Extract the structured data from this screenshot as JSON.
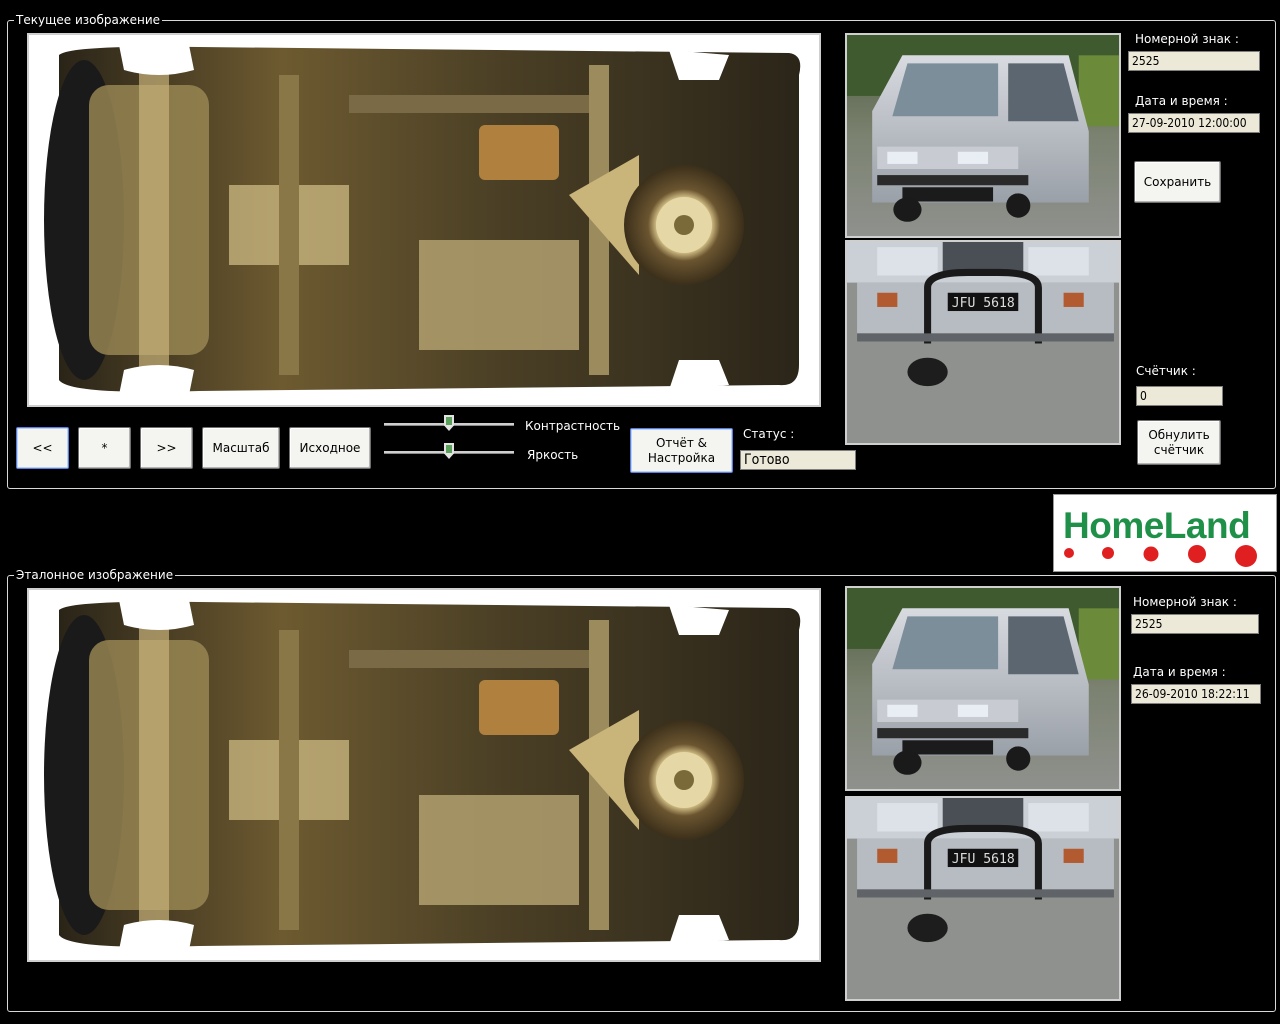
{
  "current": {
    "title": "Текущее изображение",
    "plate_label": "Номерной знак :",
    "plate_value": "2525",
    "datetime_label": "Дата и время :",
    "datetime_value": "27-09-2010 12:00:00",
    "save_label": "Сохранить",
    "counter_label": "Счётчик :",
    "counter_value": "0",
    "reset_counter_label": "Обнулить счётчик",
    "plate_text": "JFU 5618"
  },
  "controls": {
    "prev_label": "<<",
    "star_label": "*",
    "next_label": ">>",
    "scale_label": "Масштаб",
    "original_label": "Исходное",
    "contrast_label": "Контрастность",
    "contrast_level": 0.5,
    "brightness_label": "Яркость",
    "brightness_level": 0.5,
    "report_label": "Отчёт & Настройка",
    "status_label": "Статус :",
    "status_value": "Готово"
  },
  "reference": {
    "title": "Эталонное изображение",
    "plate_label": "Номерной знак :",
    "plate_value": "2525",
    "datetime_label": "Дата и время :",
    "datetime_value": "26-09-2010 18:22:11",
    "plate_text": "JFU 5618"
  },
  "logo": {
    "text": "HomeLand",
    "text_color": "#1e9048",
    "dot_color": "#e02020"
  },
  "icons": {
    "undercarriage": "vehicle-undercarriage-image",
    "van_front": "van-front-photo",
    "bumper": "bumper-plate-closeup-photo"
  }
}
